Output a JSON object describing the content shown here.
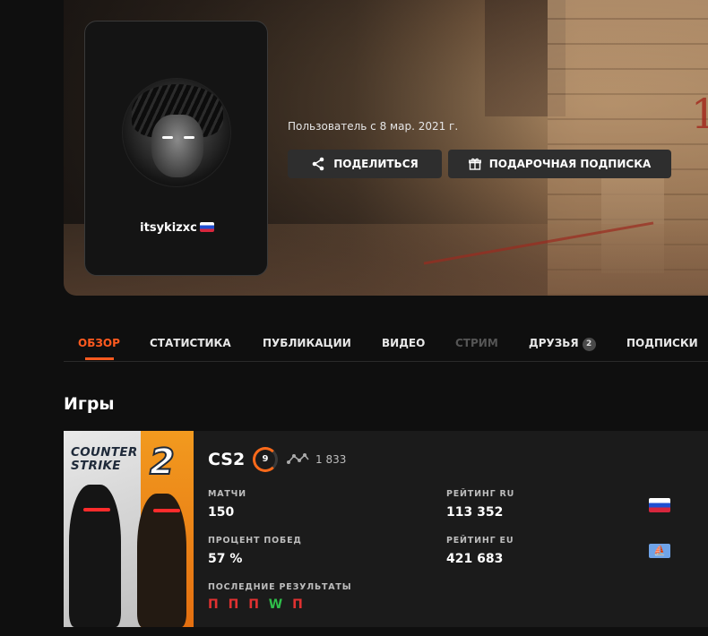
{
  "profile": {
    "username": "itsykizxc",
    "member_since": "Пользователь с 8 мар. 2021 г.",
    "share_label": "ПОДЕЛИТЬСЯ",
    "gift_label": "ПОДАРОЧНАЯ ПОДПИСКА"
  },
  "tabs": [
    {
      "label": "ОБЗОР",
      "state": "active"
    },
    {
      "label": "СТАТИСТИКА"
    },
    {
      "label": "ПУБЛИКАЦИИ"
    },
    {
      "label": "ВИДЕО"
    },
    {
      "label": "СТРИМ",
      "state": "disabled"
    },
    {
      "label": "ДРУЗЬЯ",
      "badge": "2"
    },
    {
      "label": "ПОДПИСКИ"
    }
  ],
  "games_title": "Игры",
  "game": {
    "cover_text_line1": "COUNTER",
    "cover_text_line2": "STRIKE",
    "cover_number": "2",
    "name": "CS2",
    "level": "9",
    "elo": "1 833",
    "matches_label": "МАТЧИ",
    "matches_value": "150",
    "winrate_label": "ПРОЦЕНТ ПОБЕД",
    "winrate_value": "57 %",
    "rating_ru_label": "РЕЙТИНГ RU",
    "rating_ru_value": "113 352",
    "rating_eu_label": "РЕЙТИНГ EU",
    "rating_eu_value": "421 683",
    "recent_label": "ПОСЛЕДНИЕ РЕЗУЛЬТАТЫ",
    "recent_results": [
      "П",
      "П",
      "П",
      "W",
      "П"
    ]
  },
  "colors": {
    "accent": "#ff5a1f",
    "win": "#2fbf4a",
    "loss": "#e03131"
  },
  "icons": {
    "share": "share-icon",
    "gift": "gift-icon",
    "elo": "elo-graph-icon",
    "eu_region": "eu-region-icon"
  }
}
